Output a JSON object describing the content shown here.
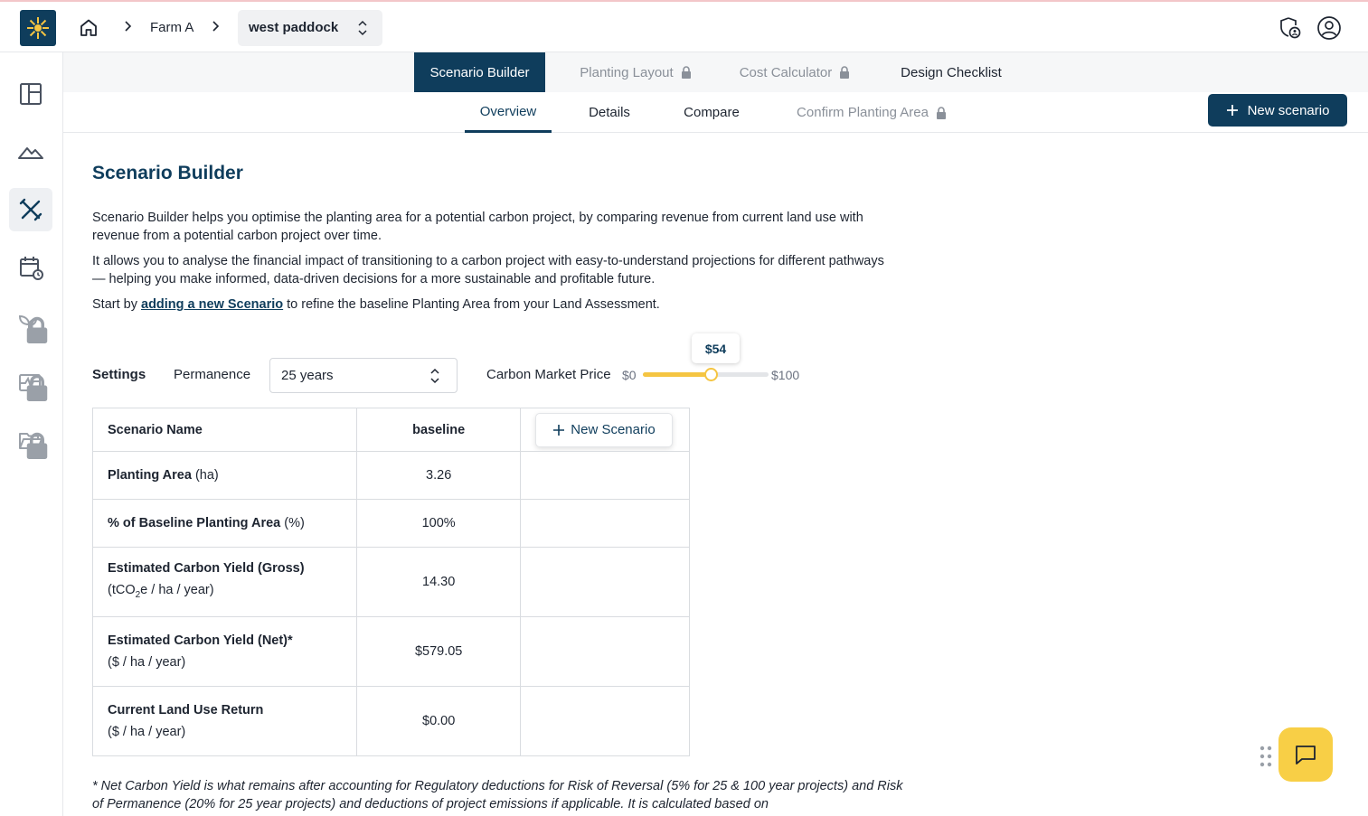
{
  "breadcrumb": {
    "farm": "Farm A",
    "paddock": "west paddock"
  },
  "tabs_primary": [
    {
      "label": "Scenario Builder",
      "active": true,
      "locked": false
    },
    {
      "label": "Planting Layout",
      "active": false,
      "locked": true
    },
    {
      "label": "Cost Calculator",
      "active": false,
      "locked": true
    },
    {
      "label": "Design Checklist",
      "active": false,
      "locked": false
    }
  ],
  "tabs_secondary": [
    {
      "label": "Overview",
      "active": true,
      "locked": false
    },
    {
      "label": "Details",
      "active": false,
      "locked": false
    },
    {
      "label": "Compare",
      "active": false,
      "locked": false
    },
    {
      "label": "Confirm Planting Area",
      "active": false,
      "locked": true
    }
  ],
  "new_scenario_top_label": "New scenario",
  "page": {
    "title": "Scenario Builder",
    "para1": "Scenario Builder helps you optimise the planting area for a potential carbon project, by comparing revenue from current land use with revenue from a potential carbon project over time.",
    "para2": "It allows you to analyse the financial impact of transitioning to a carbon project with easy-to-understand projections for different pathways — helping you make informed, data-driven decisions for a more sustainable and profitable future.",
    "para3_before": "Start by ",
    "para3_link": "adding a new Scenario",
    "para3_after": " to refine the baseline Planting Area from your Land Assessment."
  },
  "settings": {
    "label": "Settings",
    "permanence_label": "Permanence",
    "permanence_value": "25 years",
    "carbon_price_label": "Carbon Market Price",
    "min_label": "$0",
    "max_label": "$100",
    "min": 0,
    "max": 100,
    "value": 54,
    "value_label": "$54"
  },
  "table": {
    "header_name": "Scenario Name",
    "header_baseline": "baseline",
    "new_scenario_label": "New Scenario",
    "rows": [
      {
        "name": "Planting Area",
        "unit": " (ha)",
        "value": "3.26"
      },
      {
        "name": "% of Baseline Planting Area",
        "unit": " (%)",
        "value": "100%"
      },
      {
        "name": "Estimated Carbon Yield (Gross)",
        "unit_pre": "(tCO",
        "unit_sub": "2",
        "unit_post": "e / ha / year)",
        "value": "14.30"
      },
      {
        "name": "Estimated Carbon Yield (Net)*",
        "unit": "($ / ha / year)",
        "value": "$579.05"
      },
      {
        "name": "Current Land Use Return",
        "unit": "($ / ha / year)",
        "value": "$0.00"
      }
    ]
  },
  "footnote": "* Net Carbon Yield is what remains after accounting for Regulatory deductions for Risk of Reversal (5% for 25 & 100 year projects) and Risk of Permanence (20% for 25 year projects) and deductions of project emissions if applicable. It is calculated based on"
}
